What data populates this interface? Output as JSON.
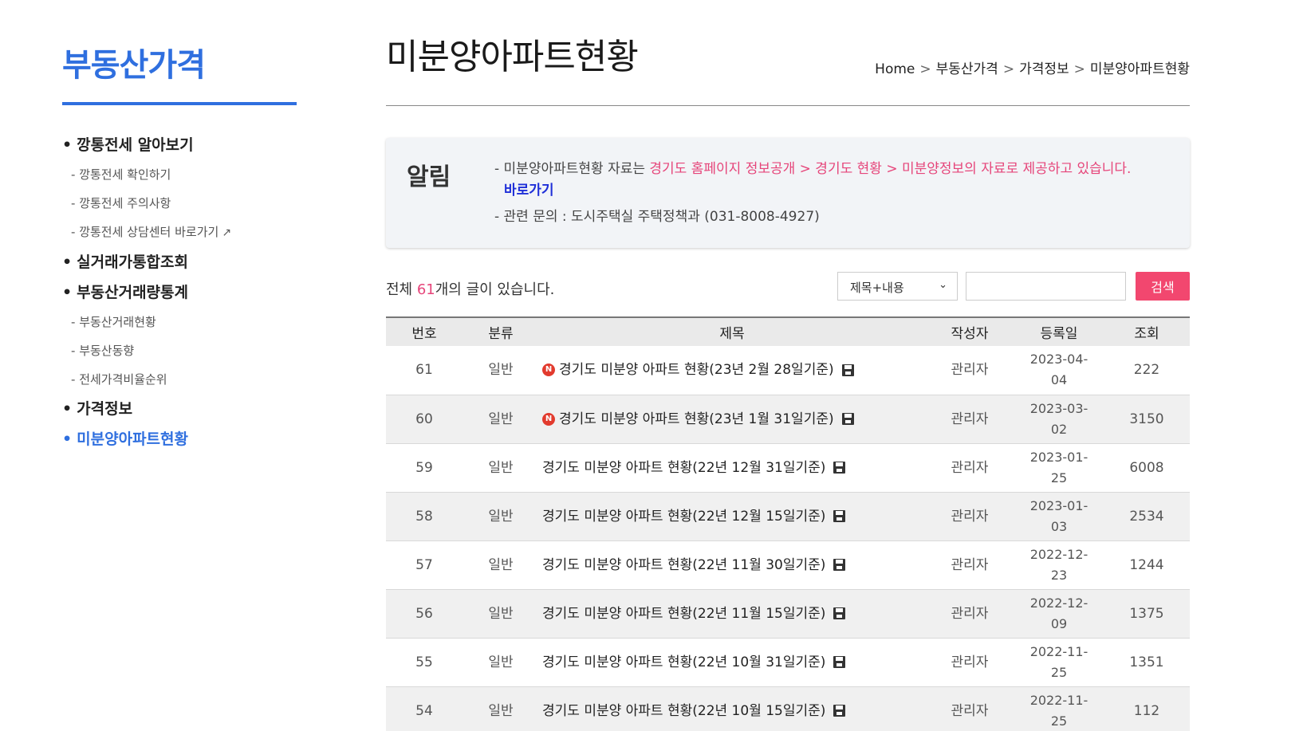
{
  "sidebar": {
    "title": "부동산가격",
    "groups": [
      {
        "label": "깡통전세 알아보기",
        "items": [
          "깡통전세 확인하기",
          "깡통전세 주의사항",
          "깡통전세 상담센터 바로가기"
        ]
      },
      {
        "label": "실거래가통합조회",
        "items": []
      },
      {
        "label": "부동산거래량통계",
        "items": [
          "부동산거래현황",
          "부동산동향",
          "전세가격비율순위"
        ]
      },
      {
        "label": "가격정보",
        "items": []
      },
      {
        "label": "미분양아파트현황",
        "items": [],
        "active": true
      }
    ],
    "external_icon": "external-link-icon"
  },
  "page": {
    "title": "미분양아파트현황",
    "breadcrumb": [
      "Home",
      "부동산가격",
      "가격정보",
      "미분양아파트현황"
    ]
  },
  "notice": {
    "label": "알림",
    "line1_prefix": "미분양아파트현황 자료는 ",
    "line1_highlight": "경기도 홈페이지 정보공개 > 경기도 현황 > 미분양정보의 자료로 제공하고 있습니다.",
    "link_label": "바로가기",
    "line2": "관련 문의 : 도시주택실 주택정책과 (031-8008-4927)"
  },
  "search": {
    "total_prefix": "전체 ",
    "total_count": "61",
    "total_suffix": "개의 글이 있습니다.",
    "select_value": "제목+내용",
    "input_placeholder": "",
    "button_label": "검색"
  },
  "table": {
    "headers": [
      "번호",
      "분류",
      "제목",
      "작성자",
      "등록일",
      "조회"
    ],
    "rows": [
      {
        "no": "61",
        "category": "일반",
        "title": "경기도 미분양 아파트 현황(23년 2월 28일기준)",
        "is_new": true,
        "author": "관리자",
        "date_a": "2023-04-",
        "date_b": "04",
        "views": "222"
      },
      {
        "no": "60",
        "category": "일반",
        "title": "경기도 미분양 아파트 현황(23년 1월 31일기준)",
        "is_new": true,
        "author": "관리자",
        "date_a": "2023-03-",
        "date_b": "02",
        "views": "3150"
      },
      {
        "no": "59",
        "category": "일반",
        "title": "경기도 미분양 아파트 현황(22년 12월 31일기준)",
        "is_new": false,
        "author": "관리자",
        "date_a": "2023-01-",
        "date_b": "25",
        "views": "6008"
      },
      {
        "no": "58",
        "category": "일반",
        "title": "경기도 미분양 아파트 현황(22년 12월 15일기준)",
        "is_new": false,
        "author": "관리자",
        "date_a": "2023-01-",
        "date_b": "03",
        "views": "2534"
      },
      {
        "no": "57",
        "category": "일반",
        "title": "경기도 미분양 아파트 현황(22년 11월 30일기준)",
        "is_new": false,
        "author": "관리자",
        "date_a": "2022-12-",
        "date_b": "23",
        "views": "1244"
      },
      {
        "no": "56",
        "category": "일반",
        "title": "경기도 미분양 아파트 현황(22년 11월 15일기준)",
        "is_new": false,
        "author": "관리자",
        "date_a": "2022-12-",
        "date_b": "09",
        "views": "1375"
      },
      {
        "no": "55",
        "category": "일반",
        "title": "경기도 미분양 아파트 현황(22년 10월 31일기준)",
        "is_new": false,
        "author": "관리자",
        "date_a": "2022-11-",
        "date_b": "25",
        "views": "1351"
      },
      {
        "no": "54",
        "category": "일반",
        "title": "경기도 미분양 아파트 현황(22년 10월 15일기준)",
        "is_new": false,
        "author": "관리자",
        "date_a": "2022-11-",
        "date_b": "25",
        "views": "112"
      }
    ],
    "new_badge": "N",
    "file_icon": "floppy-disk-icon"
  },
  "colors": {
    "accent": "#2f6fdf",
    "highlight": "#e6457a",
    "search_button": "#f2476f"
  }
}
